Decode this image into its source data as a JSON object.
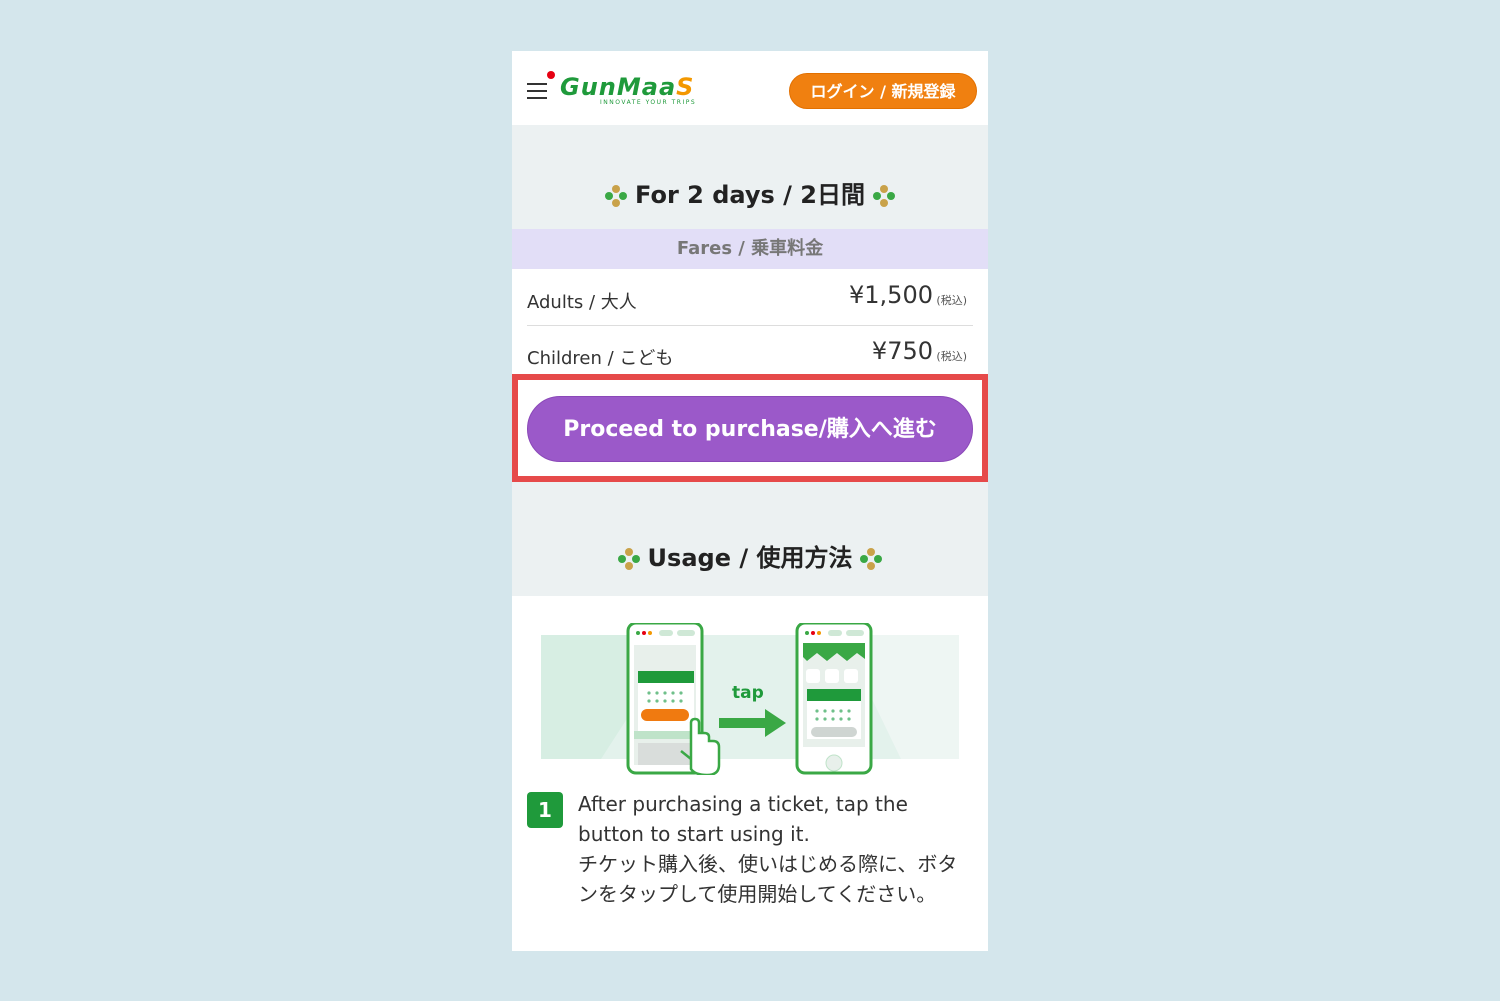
{
  "header": {
    "logo_text_main": "GunMaa",
    "logo_text_s": "S",
    "logo_tagline": "INNOVATE YOUR TRIPS",
    "login_label": "ログイン / 新規登録"
  },
  "pass": {
    "title": "For 2 days / 2日間",
    "fares_label": "Fares / 乗車料金",
    "rows": [
      {
        "label": "Adults / 大人",
        "price": "¥1,500",
        "tax": "(税込)"
      },
      {
        "label": "Children / こども",
        "price": "¥750",
        "tax": "(税込)"
      }
    ],
    "purchase_label": "Proceed to purchase/購入へ進む"
  },
  "usage": {
    "title": "Usage / 使用方法",
    "tap_label": "tap",
    "step_number": "1",
    "step_lines": [
      "After purchasing a ticket, tap the",
      "button to start using it.",
      "チケット購入後、使いはじめる際に、ボタ",
      "ンをタップして使用開始してください。"
    ]
  },
  "colors": {
    "page_bg": "#d4e6ec",
    "brand_green": "#1f9a3b",
    "login_orange": "#f08010",
    "purchase_purple": "#9b59c9",
    "highlight_red": "#e64a4a",
    "fares_bar": "#e2def7"
  }
}
